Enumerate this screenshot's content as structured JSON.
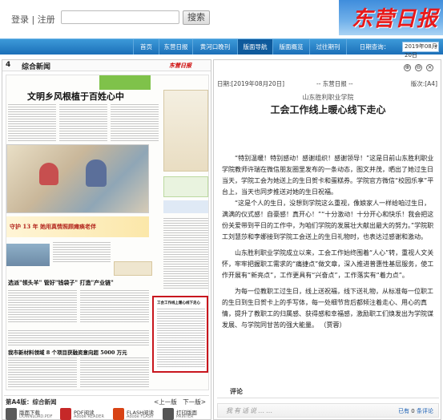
{
  "header": {
    "login_label": "登录",
    "separator": "|",
    "register_label": "注册",
    "search_button": "搜索",
    "search_placeholder": "",
    "logo_text": "东营日报"
  },
  "nav": {
    "items": [
      "首页",
      "东营日报",
      "黄河口晚刊",
      "版面导航",
      "版面概览",
      "过往期刊",
      "日期查询："
    ],
    "active_index": 3,
    "date_value": "2019年08月20日"
  },
  "paper": {
    "page_number": "4",
    "page_name": "综合新闻",
    "page_logo": "东营日报",
    "headline_1": "文明乡风根植于百姓心中",
    "headline_2": "守护 13 年  她用真情照顾瘫痪老伴",
    "headline_3": "选派\"领头羊\" 管好\"钱袋子\" 打造\"产业链\"",
    "headline_4": "我市新材料领域 8 个项目获融资意向超 5000 万元",
    "box_title": "工会工作线上暖心线下走心",
    "footer_page": "第A4版：综合新闻",
    "prev_label": "<上一版",
    "next_label": "下一版>"
  },
  "downloads": [
    {
      "title": "版面下载",
      "sub": "DOWNLOAD.PDF",
      "color": "#5a5a5a"
    },
    {
      "title": "PDF阅读",
      "sub": "Adobe READER",
      "color": "#c62828"
    },
    {
      "title": "FLASH阅读",
      "sub": "Adobe FLASH",
      "color": "#d84315"
    },
    {
      "title": "打印版面",
      "sub": "PRINTER",
      "color": "#555555"
    }
  ],
  "article": {
    "controls": [
      "⊕",
      "⊖",
      "×"
    ],
    "date": "日期:[2019年08月20日]",
    "paper_name": "-- 东营日报 --",
    "page_ref": "版次:[A4]",
    "kicker": "山东胜利职业学院",
    "headline": "工会工作线上暖心线下走心",
    "paragraphs": [
      "“特别温暖！特别感动！感谢组织！感谢领导！”这是日前山东胜利职业学院教师许瑞在微信朋友圈里发布的一条动态，图文并茂，晒出了她过生日当天，学院工会为她送上的生日贺卡和蛋糕券。学院官方微信“校园乐享”平台上，当天也同步推送对她的生日祝福。",
      "“这是个人的生日，没想到学院这么重视，像娘家人一样给咱过生日，满满的仪式感！自豪感！真开心！”“十分激动！十分开心和快乐！我会把这份关爱带到平日的工作中，为咱们学院的发展壮大献出最大的努力。”学院职工刘慧莎和李娜接到学院工会送上的生日礼物时，也表达过感谢和激动。",
      "山东胜利职业学院成立以来，工会工作始终围着“人心”转，重视人文关怀，牢牢把握职工需求的“痛捷点”做文章，深入推进普惠性基层服务，使工作开展有“新亮点”，工作更具有“兴奋点”，工作落实有“着力点”。",
      "为每一位教职工过生日，线上送祝福，线下送礼物，从标准每一位职工的生日到生日贺卡上的手写体，每一处细节背后都倾注着走心、用心的真情，提升了教职工的归属感、获得感和幸福感，激励职工们焕发出为学院谋发展、与学院同甘苦的强大能量。   （贾蓉）"
    ],
    "comment_label": "评论",
    "comment_title": "我有话说……",
    "comment_have": "已有",
    "comment_count": "0",
    "comment_suffix": "条评论"
  }
}
